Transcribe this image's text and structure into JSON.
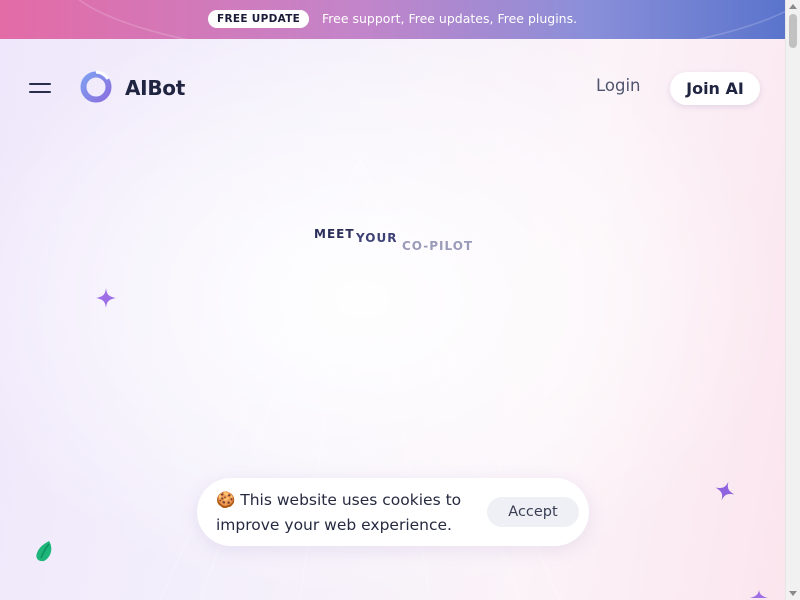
{
  "banner": {
    "badge": "FREE UPDATE",
    "text": "Free support, Free updates, Free plugins."
  },
  "nav": {
    "menu_icon": "hamburger-menu-icon",
    "logo_icon": "ring-logo-icon",
    "logo_text": "AIBot",
    "login_label": "Login",
    "join_label": "Join AI"
  },
  "hero": {
    "eyebrow_words": [
      "MEET",
      "YOUR",
      "CO-PILOT"
    ]
  },
  "cookie": {
    "emoji": "🍪",
    "message": "This website uses cookies to improve your web experience.",
    "accept_label": "Accept"
  },
  "widget": {
    "icon": "leaf-icon"
  },
  "colors": {
    "banner_start": "#e36ba6",
    "banner_end": "#5a74cc",
    "text_dark": "#1f2440",
    "sparkle": "#9d6ee6",
    "leaf_green": "#1db57a"
  }
}
